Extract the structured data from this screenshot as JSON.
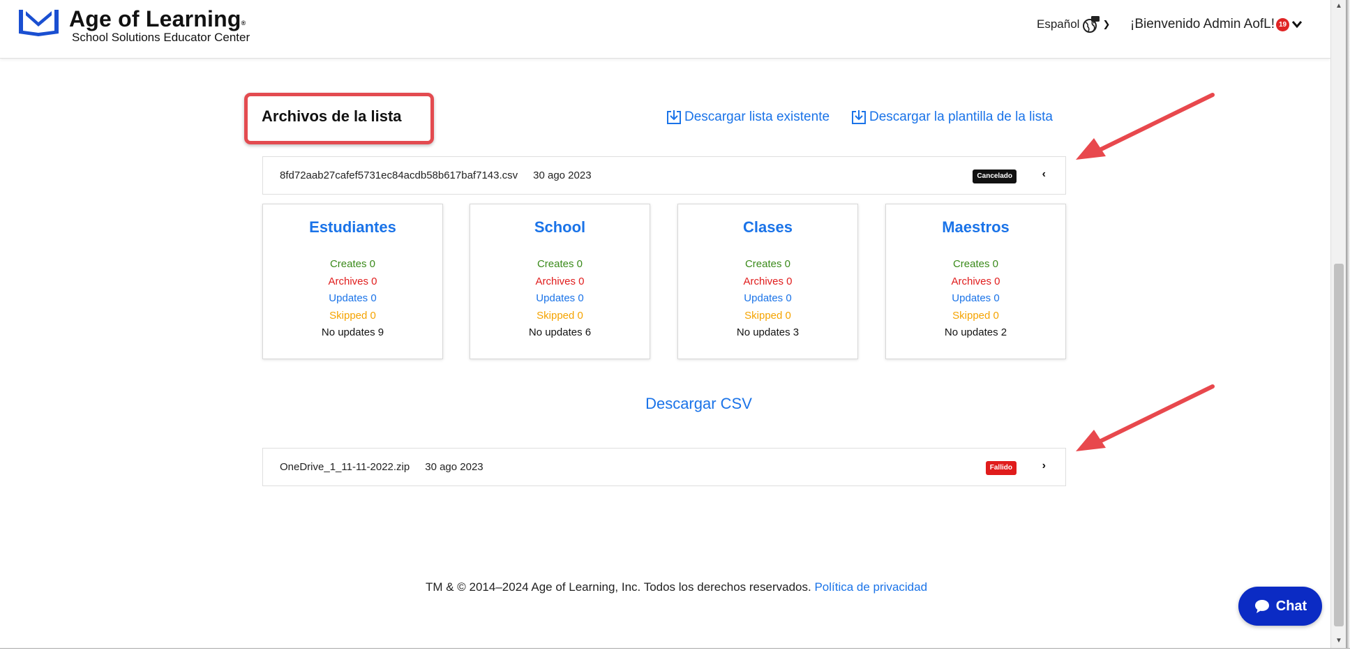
{
  "header": {
    "logo_name": "Age of Learning",
    "logo_mark": "®",
    "logo_sub": "School Solutions Educator Center",
    "language": "Español",
    "welcome": "¡Bienvenido Admin AofL!",
    "notification_count": "19"
  },
  "title": "Archivos de la lista",
  "links": {
    "download_existing": "Descargar lista existente",
    "download_template": "Descargar la plantilla de la lista",
    "download_csv": "Descargar CSV"
  },
  "files": [
    {
      "name": "8fd72aab27cafef5731ec84acdb58b617baf7143.csv",
      "date": "30 ago 2023",
      "status": "Cancelado",
      "status_color": "#111111",
      "chevron": "‹"
    },
    {
      "name": "OneDrive_1_11-11-2022.zip",
      "date": "30 ago 2023",
      "status": "Fallido",
      "status_color": "#e01c1c",
      "chevron": "›"
    }
  ],
  "cards": [
    {
      "title": "Estudiantes",
      "creates": "Creates 0",
      "archives": "Archives 0",
      "updates": "Updates 0",
      "skipped": "Skipped 0",
      "no_updates": "No updates 9"
    },
    {
      "title": "School",
      "creates": "Creates 0",
      "archives": "Archives 0",
      "updates": "Updates 0",
      "skipped": "Skipped 0",
      "no_updates": "No updates 6"
    },
    {
      "title": "Clases",
      "creates": "Creates 0",
      "archives": "Archives 0",
      "updates": "Updates 0",
      "skipped": "Skipped 0",
      "no_updates": "No updates 3"
    },
    {
      "title": "Maestros",
      "creates": "Creates 0",
      "archives": "Archives 0",
      "updates": "Updates 0",
      "skipped": "Skipped 0",
      "no_updates": "No updates 2"
    }
  ],
  "footer": {
    "text": "TM & © 2014–2024 Age of Learning, Inc. Todos los derechos reservados.",
    "privacy": "Política de privacidad"
  },
  "chat_label": "Chat",
  "colors": {
    "brand_blue": "#1a73e8",
    "annotation_red": "#e34b50",
    "chat_blue": "#0b2bc4"
  }
}
